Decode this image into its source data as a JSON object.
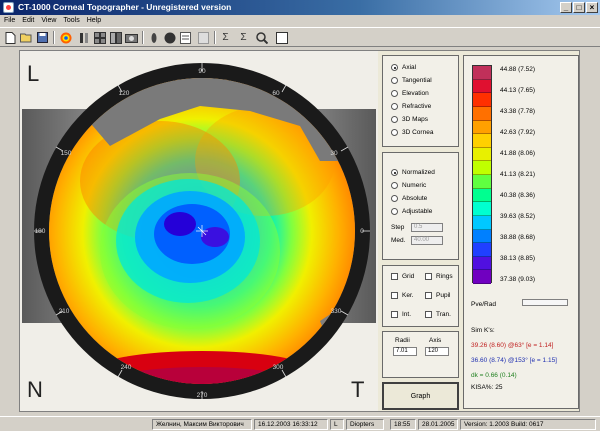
{
  "window": {
    "title": "CT-1000 Corneal Topographer - Unregistered version"
  },
  "menu": [
    "File",
    "Edit",
    "View",
    "Tools",
    "Help"
  ],
  "toolbar_icons": [
    "new-icon",
    "open-icon",
    "save-icon",
    "color-map-icon",
    "grid-icon",
    "compare-icon",
    "columns-icon",
    "camera-icon",
    "eye-icon",
    "sphere-icon",
    "page-icon",
    "page-icon-2",
    "sigma-icon",
    "sigma-icon-2",
    "zoom-icon",
    "frame-icon"
  ],
  "corners": {
    "tl": "L",
    "bl": "N",
    "br": "T"
  },
  "axis_degrees": [
    "90",
    "60",
    "30",
    "0",
    "330",
    "300",
    "270",
    "240",
    "210",
    "180",
    "150",
    "120"
  ],
  "map_types": {
    "items": [
      "Axial",
      "Tangential",
      "Elevation",
      "Refractive",
      "3D Maps",
      "3D Cornea"
    ],
    "selected": 0
  },
  "scale_types": {
    "items": [
      "Normalized",
      "Numeric",
      "Absolute",
      "Adjustable"
    ],
    "selected": 0
  },
  "step": {
    "label": "Step",
    "value": "0.5"
  },
  "med": {
    "label": "Med.",
    "value": "40.00"
  },
  "overlays": [
    {
      "left": "Grid",
      "right": "Rings"
    },
    {
      "left": "Ker.",
      "right": "Pupil"
    },
    {
      "left": "Int.",
      "right": "Tran."
    }
  ],
  "radii": {
    "label": "Radii",
    "value": "7.01"
  },
  "axis": {
    "label": "Axis",
    "value": "120"
  },
  "graph_button": "Graph",
  "scale": {
    "labels": [
      "44.88 (7.52)",
      "44.13 (7.65)",
      "43.38 (7.78)",
      "42.63 (7.92)",
      "41.88 (8.06)",
      "41.13 (8.21)",
      "40.38 (8.36)",
      "39.63 (8.52)",
      "38.88 (8.68)",
      "38.13 (8.85)",
      "37.38 (9.03)"
    ],
    "colors": [
      "#c0305a",
      "#e01030",
      "#ff3000",
      "#ff7000",
      "#ffa000",
      "#ffd000",
      "#e8f000",
      "#c0ff00",
      "#60ff40",
      "#00ff90",
      "#00ffd0",
      "#00c8ff",
      "#0080ff",
      "#2040ff",
      "#5010e0",
      "#7000c0"
    ]
  },
  "pve_rad": {
    "label": "Pve/Rad"
  },
  "sim_k": {
    "title": "Sim K's:",
    "k1": "39.26 (8.60) @63° [e = 1.14]",
    "k2": "36.60 (8.74) @153° [e = 1.15]",
    "dk": "dk = 0.66 (0.14)",
    "kisa": "KISA%: 25"
  },
  "status": {
    "patient": "Желнин, Максим Викторович",
    "datetime": "16.12.2003 16:33:12",
    "eye": "L",
    "units": "Diopters",
    "time": "18:55",
    "date": "28.01.2005",
    "version": "Version: 1.2003  Build: 0617"
  }
}
